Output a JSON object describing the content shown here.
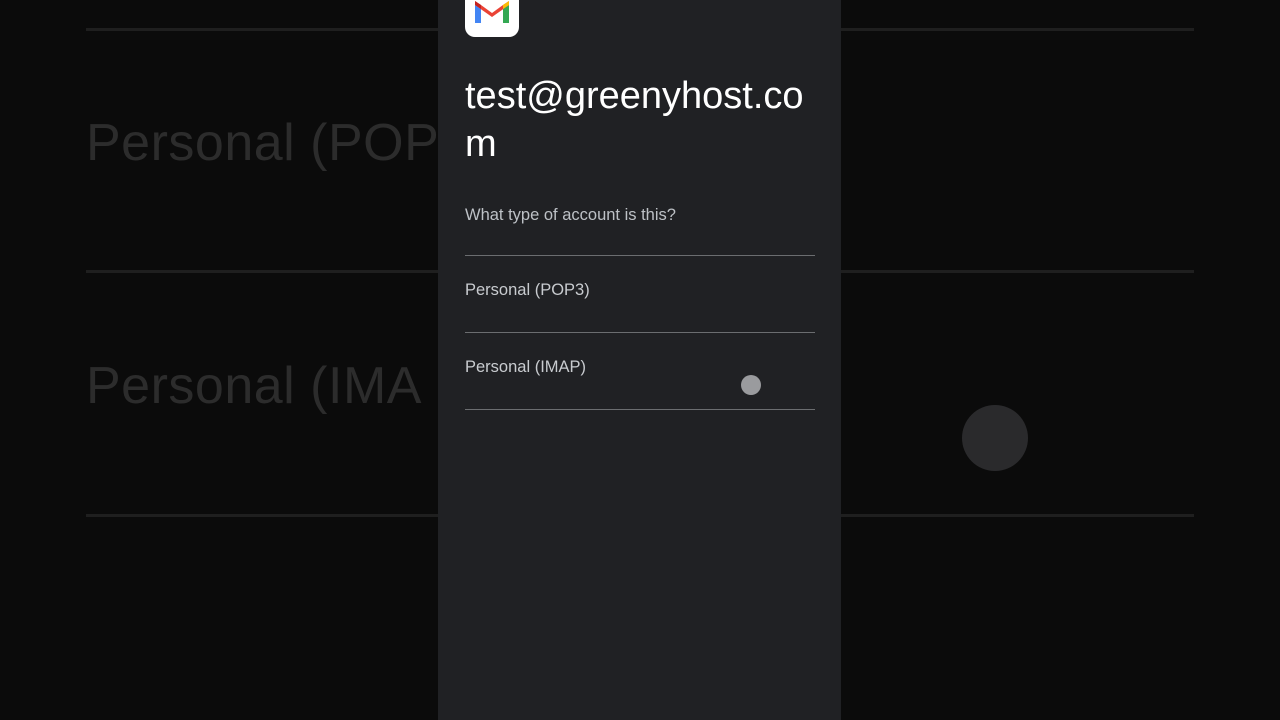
{
  "background": {
    "option_1": "Personal (POP",
    "option_2": "Personal (IMA"
  },
  "app": {
    "icon": "gmail-icon"
  },
  "account": {
    "email": "test@greenyhost.com"
  },
  "prompt": {
    "question": "What type of account is this?"
  },
  "options": [
    {
      "label": "Personal (POP3)"
    },
    {
      "label": "Personal (IMAP)"
    }
  ],
  "colors": {
    "screen_bg": "#202124",
    "text_primary": "#ffffff",
    "text_secondary": "#bdc1c6",
    "divider": "#6b6d70"
  }
}
